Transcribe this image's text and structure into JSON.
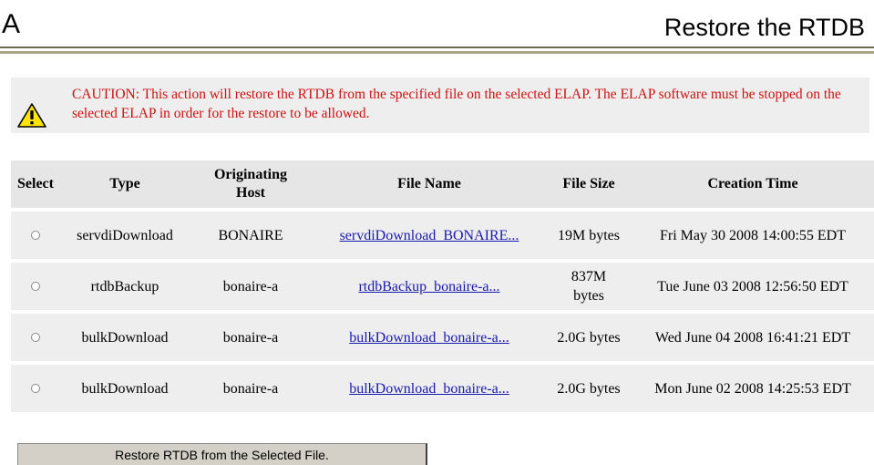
{
  "header": {
    "letter": "A",
    "title": "Restore the RTDB"
  },
  "caution": {
    "icon": "warning-icon",
    "text": "CAUTION: This action will restore the RTDB from the specified file on the selected ELAP. The ELAP software must be stopped on the selected ELAP in order for the restore to be allowed.",
    "color": "#cc1111"
  },
  "table": {
    "headers": {
      "select": "Select",
      "type": "Type",
      "host": "Originating Host",
      "file_name": "File Name",
      "file_size": "File Size",
      "creation_time": "Creation Time"
    },
    "rows": [
      {
        "type": "servdiDownload",
        "host": "BONAIRE",
        "file_name": "servdiDownload_BONAIRE...",
        "file_size": "19M bytes",
        "creation_time": "Fri May 30 2008 14:00:55 EDT",
        "selected": false
      },
      {
        "type": "rtdbBackup",
        "host": "bonaire-a",
        "file_name": "rtdbBackup_bonaire-a...",
        "file_size": "837M bytes",
        "creation_time": "Tue June 03 2008 12:56:50 EDT",
        "selected": false
      },
      {
        "type": "bulkDownload",
        "host": "bonaire-a",
        "file_name": "bulkDownload_bonaire-a...",
        "file_size": "2.0G bytes",
        "creation_time": "Wed June 04 2008 16:41:21 EDT",
        "selected": false
      },
      {
        "type": "bulkDownload",
        "host": "bonaire-a",
        "file_name": "bulkDownload_bonaire-a...",
        "file_size": "2.0G bytes",
        "creation_time": "Mon June 02 2008 14:25:53 EDT",
        "selected": false
      }
    ]
  },
  "restore_button": {
    "label": "Restore RTDB from the Selected File."
  }
}
